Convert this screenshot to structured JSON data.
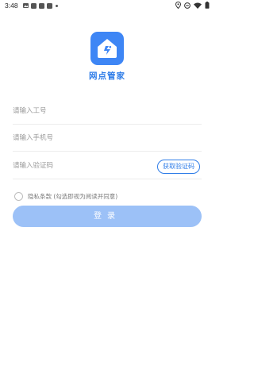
{
  "status_bar": {
    "time": "3:48",
    "notification_icons": [
      "image-icon",
      "square-icon",
      "square-icon",
      "square-icon",
      "dot-icon"
    ],
    "system_icons": [
      "location-icon",
      "do-not-disturb-icon",
      "wifi-icon",
      "battery-icon"
    ]
  },
  "app": {
    "name": "网点管家",
    "brand_color": "#3e86f5"
  },
  "form": {
    "employee_id_placeholder": "请输入工号",
    "phone_placeholder": "请输入手机号",
    "code_placeholder": "请输入验证码",
    "get_code_label": "获取验证码"
  },
  "agreement": {
    "text": "隐私条款 (勾选即视为阅读并同意)",
    "checked": false
  },
  "login": {
    "label": "登录",
    "color": "#9cc1f7"
  }
}
